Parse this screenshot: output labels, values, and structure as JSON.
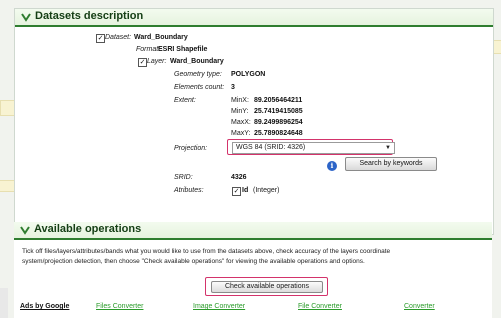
{
  "colors": {
    "accent": "#2f7d2f",
    "highlight": "#d3336b",
    "link": "#2a9b2a"
  },
  "datasets": {
    "title": "Datasets description",
    "dataset_label": "Dataset:",
    "dataset_name": "Ward_Boundary",
    "format_label": "Format:",
    "format_value": "ESRI Shapefile",
    "layer_label": "Layer:",
    "layer_name": "Ward_Boundary",
    "geometry_label": "Geometry type:",
    "geometry_value": "POLYGON",
    "elements_label": "Elements count:",
    "elements_value": "3",
    "extent_label": "Extent:",
    "extent": {
      "minx_label": "MinX:",
      "minx": "89.2056464211",
      "miny_label": "MinY:",
      "miny": "25.7419415085",
      "maxx_label": "MaxX:",
      "maxx": "89.2499896254",
      "maxy_label": "MaxY:",
      "maxy": "25.7890824648"
    },
    "projection_label": "Projection:",
    "projection_selected": "WGS 84 (SRID: 4326)",
    "search_button": "Search by keywords",
    "srid_label": "SRID:",
    "srid_value": "4326",
    "attributes_label": "Atributes:",
    "attribute_name": "Id",
    "attribute_type": "(Integer)"
  },
  "operations": {
    "title": "Available operations",
    "description_line1": "Tick off files/layers/attributes/bands what you would like to use from the datasets above, check accuracy of the layers coordinate",
    "description_line2": "system/projection detection, then choose \"Check available operations\" for viewing the available operations and options.",
    "check_button": "Check available operations"
  },
  "footer": {
    "ads": "Ads by Google",
    "links": [
      "Files Converter",
      "Image Converter",
      "File Converter",
      "Converter"
    ]
  }
}
